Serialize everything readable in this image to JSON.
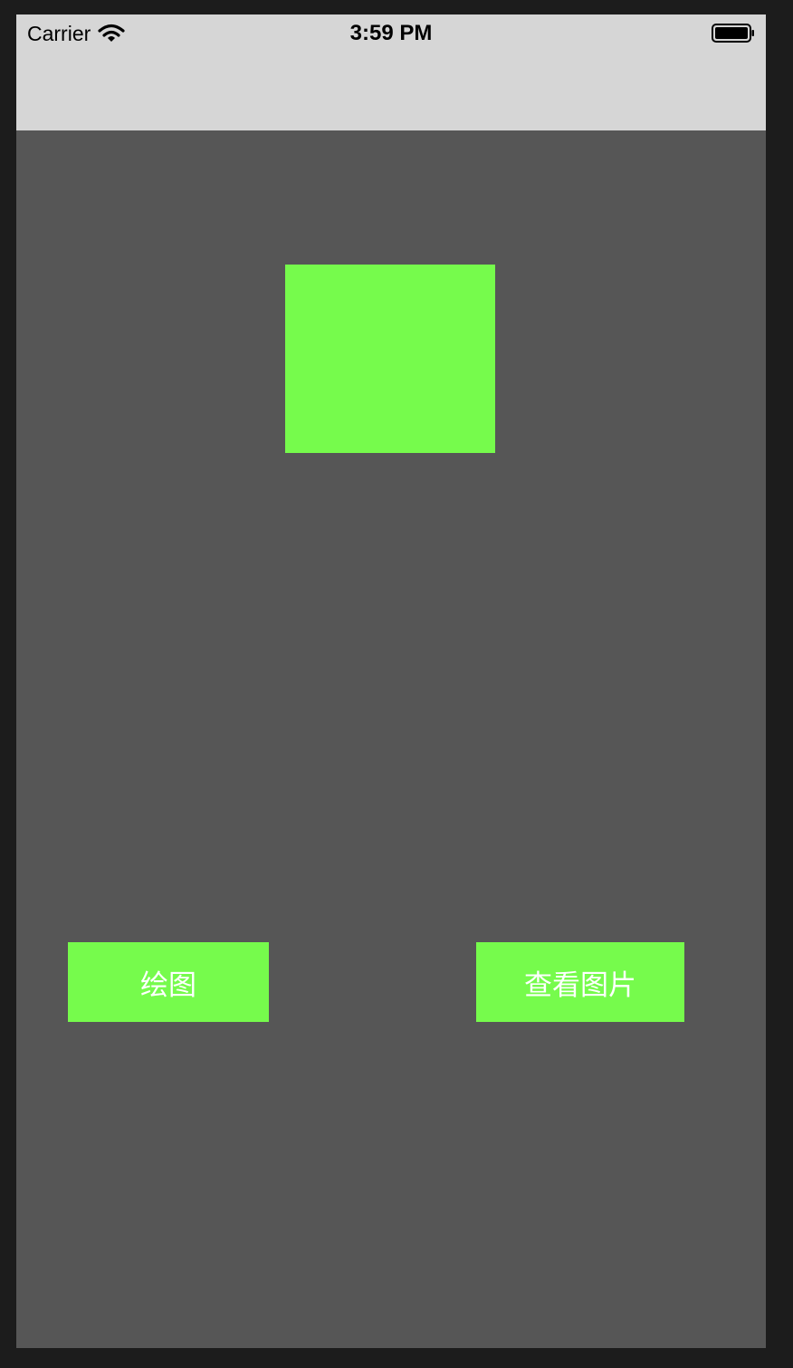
{
  "status_bar": {
    "carrier": "Carrier",
    "time": "3:59 PM",
    "icons": [
      "wifi-icon",
      "battery-icon"
    ]
  },
  "canvas": {
    "drawn_shape": "green-square"
  },
  "buttons": {
    "draw_label": "绘图",
    "view_image_label": "查看图片"
  },
  "colors": {
    "accent": "#76fb4c",
    "background": "#565656",
    "status_bar": "#d6d6d6",
    "frame": "#1c1c1c",
    "button_text": "#ffffff"
  }
}
